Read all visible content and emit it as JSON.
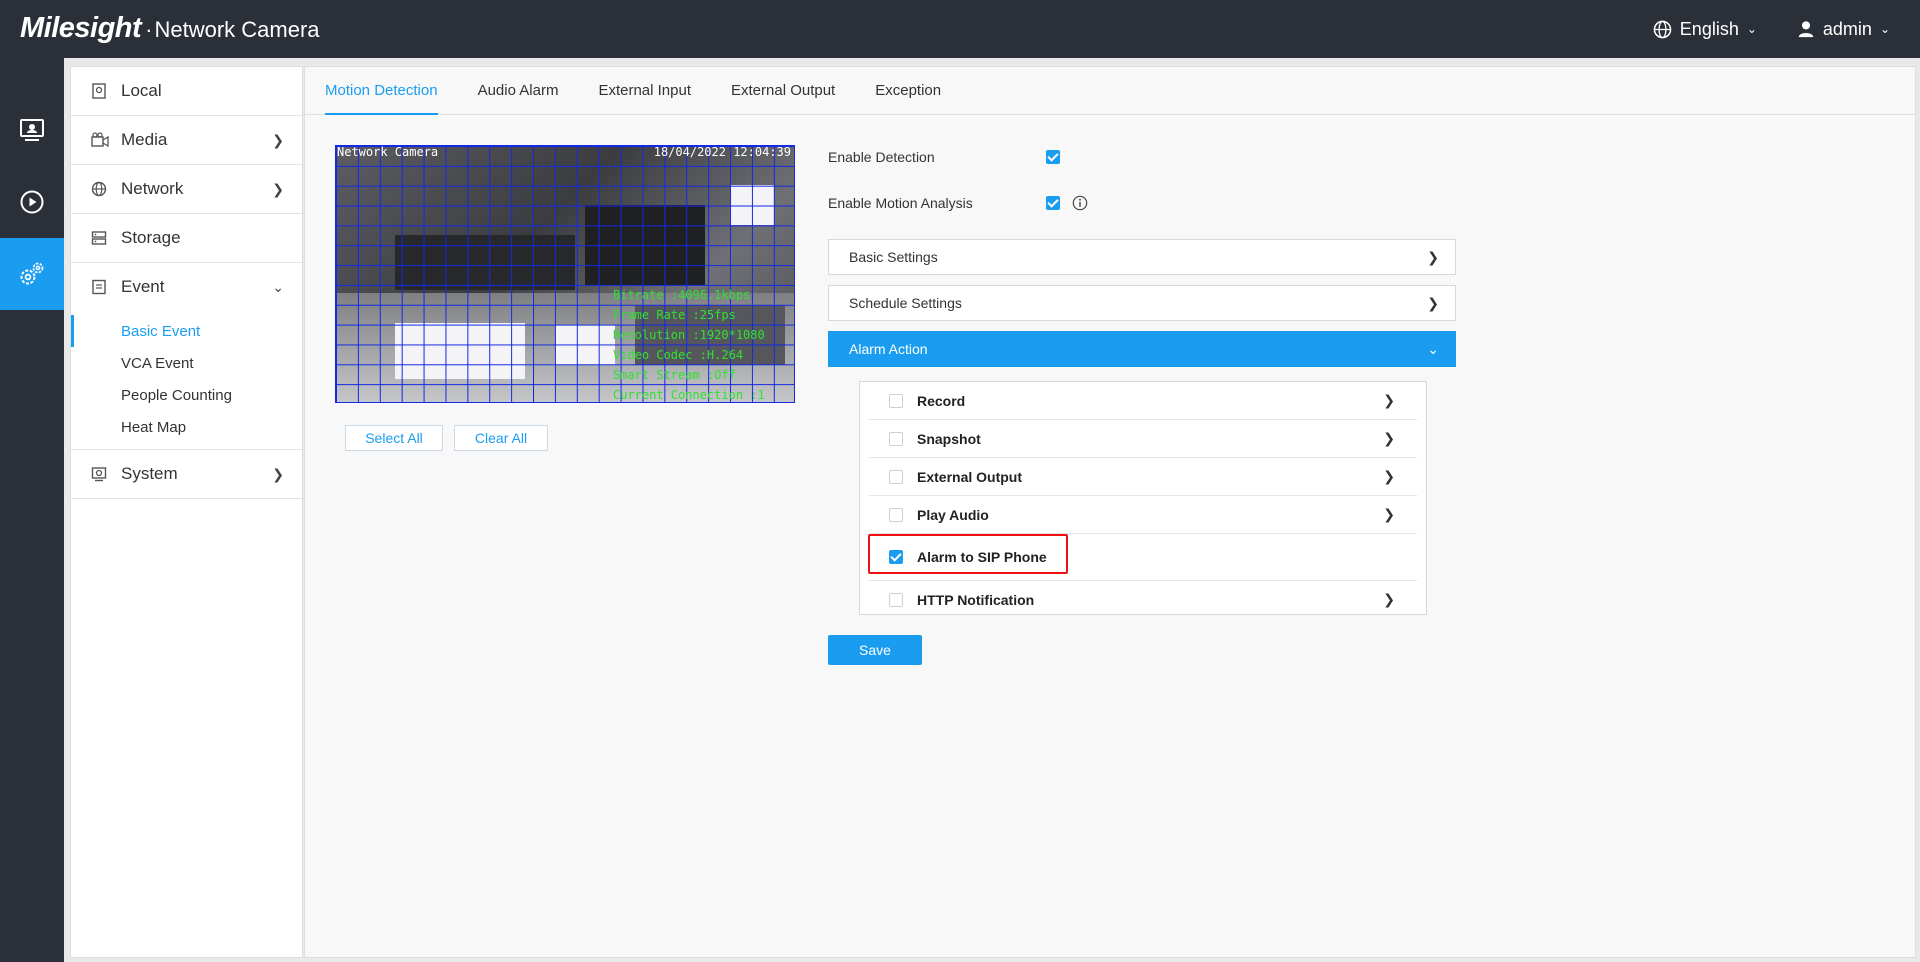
{
  "header": {
    "logo": "Milesight",
    "separator": "·",
    "title": "Network Camera",
    "language": "English",
    "user": "admin"
  },
  "rail": [
    {
      "icon": "live-view-icon"
    },
    {
      "icon": "playback-icon"
    },
    {
      "icon": "settings-icon",
      "active": true
    }
  ],
  "sidebar": {
    "items": [
      {
        "label": "Local",
        "icon": "local-icon"
      },
      {
        "label": "Media",
        "icon": "media-icon"
      },
      {
        "label": "Network",
        "icon": "globe-icon"
      },
      {
        "label": "Storage",
        "icon": "storage-icon"
      },
      {
        "label": "Event",
        "icon": "event-icon",
        "expanded": true
      },
      {
        "label": "System",
        "icon": "system-icon"
      }
    ],
    "event_submenu": [
      "Basic Event",
      "VCA Event",
      "People Counting",
      "Heat Map"
    ],
    "active_submenu": "Basic Event"
  },
  "tabs": [
    "Motion Detection",
    "Audio Alarm",
    "External Input",
    "External Output",
    "Exception"
  ],
  "active_tab": "Motion Detection",
  "video": {
    "osd_name": "Network Camera",
    "osd_datetime": "18/04/2022 12:04:39",
    "osd_lines": [
      "Bitrate :4096.1kbps",
      "Frame Rate :25fps",
      "Resolution :1920*1080",
      "Video Codec :H.264",
      "Smart Stream :Off",
      "Current Connection :1"
    ]
  },
  "buttons": {
    "select_all": "Select All",
    "clear_all": "Clear All",
    "save": "Save"
  },
  "fields": {
    "enable_detection": {
      "label": "Enable Detection",
      "checked": true
    },
    "enable_motion_analysis": {
      "label": "Enable Motion Analysis",
      "checked": true
    }
  },
  "accordions": {
    "basic_settings": "Basic Settings",
    "schedule_settings": "Schedule Settings",
    "alarm_action": "Alarm Action"
  },
  "alarm_actions": [
    {
      "label": "Record",
      "checked": false
    },
    {
      "label": "Snapshot",
      "checked": false
    },
    {
      "label": "External Output",
      "checked": false
    },
    {
      "label": "Play Audio",
      "checked": false
    },
    {
      "label": "Alarm to SIP Phone",
      "checked": true
    },
    {
      "label": "HTTP Notification",
      "checked": false
    }
  ],
  "colors": {
    "accent": "#1a9df0",
    "topbar": "#2a2f38",
    "highlight": "#e11111"
  }
}
